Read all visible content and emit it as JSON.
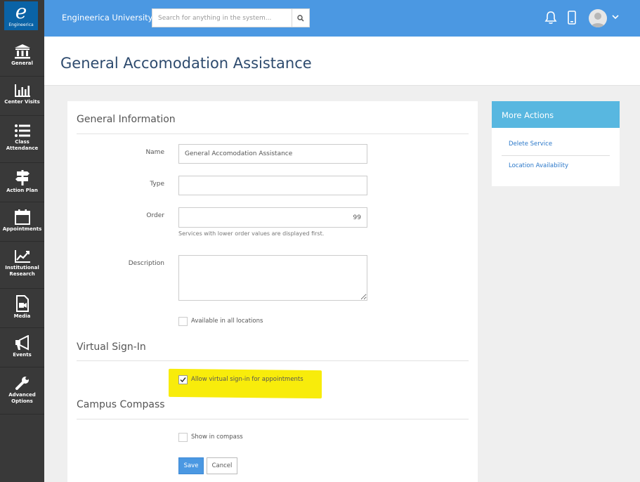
{
  "logo": {
    "letter": "e",
    "text": "Engineerica"
  },
  "sidebar": {
    "items": [
      {
        "label": "General",
        "icon": "institution-icon"
      },
      {
        "label": "Center Visits",
        "icon": "bar-chart-icon"
      },
      {
        "label": "Class Attendance",
        "icon": "list-icon"
      },
      {
        "label": "Action Plan",
        "icon": "signpost-icon"
      },
      {
        "label": "Appointments",
        "icon": "calendar-icon"
      },
      {
        "label": "Institutional Research",
        "icon": "line-chart-icon"
      },
      {
        "label": "Media",
        "icon": "media-file-icon"
      },
      {
        "label": "Events",
        "icon": "megaphone-icon"
      },
      {
        "label": "Advanced Options",
        "icon": "wrench-icon"
      }
    ]
  },
  "topbar": {
    "brand": "Engineerica University",
    "search_placeholder": "Search for anything in the system...",
    "accent": "#4b98e2"
  },
  "page": {
    "title": "General Accomodation Assistance"
  },
  "form": {
    "general_section": "General Information",
    "name_label": "Name",
    "name_value": "General Accomodation Assistance",
    "type_label": "Type",
    "type_value": "",
    "order_label": "Order",
    "order_value": "99",
    "order_help": "Services with lower order values are displayed first.",
    "description_label": "Description",
    "description_value": "",
    "available_all_label": "Available in all locations",
    "available_all_checked": false,
    "virtual_section": "Virtual Sign-In",
    "virtual_label": "Allow virtual sign-in for appointments",
    "virtual_checked": true,
    "compass_section": "Campus Compass",
    "compass_label": "Show in compass",
    "compass_checked": false,
    "save_label": "Save",
    "cancel_label": "Cancel",
    "highlight_color": "#f8ec0b"
  },
  "actions": {
    "title": "More Actions",
    "links": [
      "Delete Service",
      "Location Availability"
    ],
    "header_color": "#58b7e0"
  }
}
